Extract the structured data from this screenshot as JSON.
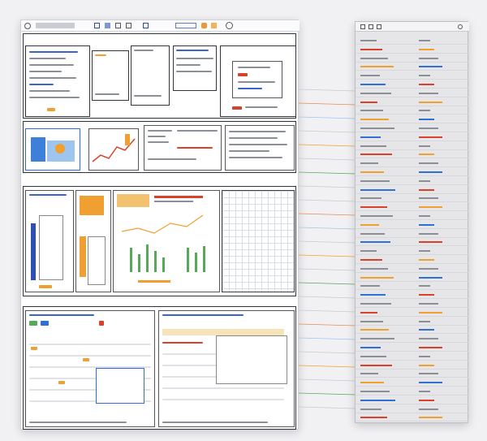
{
  "left_sheet": {
    "sections": [
      {
        "id": "overview"
      },
      {
        "id": "analytics"
      },
      {
        "id": "charts"
      },
      {
        "id": "table"
      }
    ]
  },
  "right_panel": {
    "rows": 44
  },
  "colors": {
    "accent_orange": "#f0a030",
    "accent_red": "#d9412b",
    "accent_blue": "#2f6fd6",
    "accent_green": "#58a85a",
    "frame": "#33343a"
  },
  "icons": [
    "window-icon",
    "toolbar-icon",
    "folder-icon",
    "settings-icon",
    "chart-icon"
  ]
}
